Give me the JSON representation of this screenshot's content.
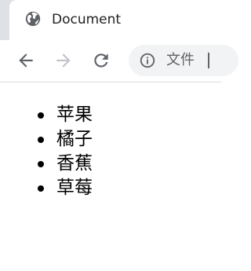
{
  "tab": {
    "title": "Document",
    "icon": "globe-icon"
  },
  "toolbar": {
    "back_icon": "back-arrow-icon",
    "forward_icon": "forward-arrow-icon",
    "reload_icon": "reload-icon",
    "address": {
      "info_icon": "info-icon",
      "text": "文件"
    }
  },
  "colors": {
    "tabstrip": "#dee1e6",
    "omnibox": "#f1f3f4",
    "icon_active": "#5f6368",
    "icon_disabled": "#c1c4c8",
    "text": "#202124"
  },
  "list": {
    "items": [
      {
        "label": "苹果"
      },
      {
        "label": "橘子"
      },
      {
        "label": "香蕉"
      },
      {
        "label": "草莓"
      }
    ]
  }
}
